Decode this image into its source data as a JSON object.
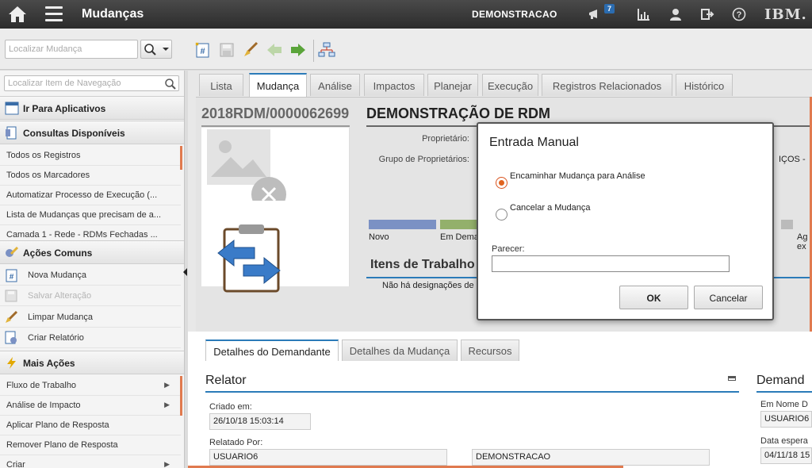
{
  "header": {
    "app_title": "Mudanças",
    "user": "DEMONSTRACAO",
    "notification_count": "7",
    "brand": "IBM."
  },
  "toolbar": {
    "search_placeholder": "Localizar Mudança"
  },
  "leftnav": {
    "search_placeholder": "Localizar Item de Navegação",
    "go_to_apps": "Ir Para Aplicativos",
    "queries_header": "Consultas Disponíveis",
    "queries": [
      "Todos os Registros",
      "Todos os Marcadores",
      "Automatizar Processo de Execução (...",
      "Lista de Mudanças que precisam de a...",
      "Camada 1 - Rede - RDMs Fechadas ..."
    ],
    "common_actions_header": "Ações Comuns",
    "common_actions": [
      "Nova Mudança",
      "Salvar Alteração",
      "Limpar Mudança",
      "Criar Relatório"
    ],
    "more_actions_header": "Mais Ações",
    "more_actions": [
      "Fluxo de Trabalho",
      "Análise de Impacto",
      "Aplicar Plano de Resposta",
      "Remover Plano de Resposta",
      "Criar"
    ]
  },
  "tabs": [
    "Lista",
    "Mudança",
    "Análise",
    "Impactos",
    "Planejar",
    "Execução",
    "Registros Relacionados",
    "Histórico"
  ],
  "record": {
    "id": "2018RDM/0000062699",
    "description": "DEMONSTRAÇÃO DE RDM",
    "owner_label": "Proprietário:",
    "owner_group_label": "Grupo de Proprietários:",
    "owner_group_value_partial": "IÇOS -",
    "status_steps": [
      "Novo",
      "Em Demar",
      "Ag",
      "ex"
    ],
    "work_items_title": "Itens de Trabalho A",
    "work_items_empty": "Não há designações de"
  },
  "subtabs": [
    "Detalhes do Demandante",
    "Detalhes da Mudança",
    "Recursos"
  ],
  "relator": {
    "title": "Relator",
    "created_label": "Criado em:",
    "created_value": "26/10/18 15:03:14",
    "reported_by_label": "Relatado Por:",
    "reported_by_value": "USUARIO6",
    "reported_by_name": "DEMONSTRACAO"
  },
  "demand": {
    "title": "Demand",
    "on_behalf_label": "Em Nome D",
    "on_behalf_value": "USUARIO6",
    "expected_label": "Data espera",
    "expected_value": "04/11/18 15"
  },
  "dialog": {
    "title": "Entrada Manual",
    "option1": "Encaminhar Mudança para Análise",
    "option2": "Cancelar a Mudança",
    "opinion_label": "Parecer:",
    "ok": "OK",
    "cancel": "Cancelar"
  },
  "colors": {
    "accent": "#2b7bb9",
    "orange": "#e07a4f",
    "status_new": "#7b91c4",
    "status_demand": "#93b06b"
  }
}
